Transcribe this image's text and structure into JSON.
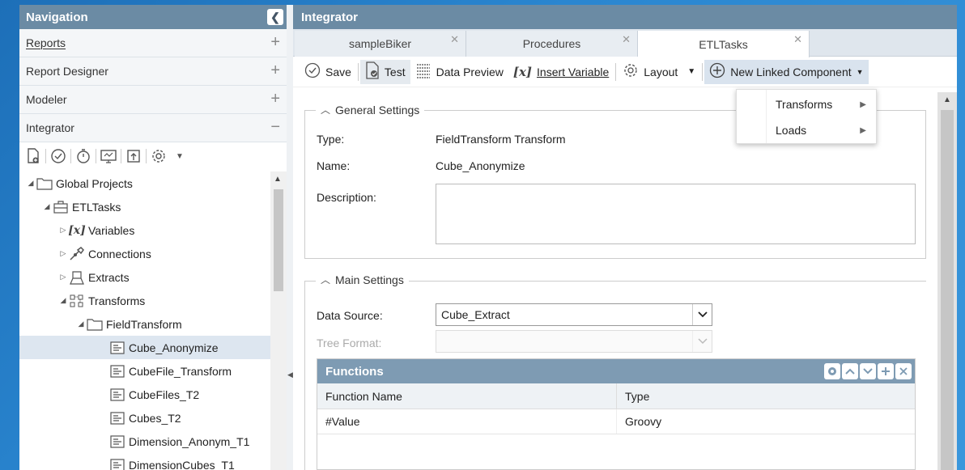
{
  "nav": {
    "title": "Navigation",
    "sections": [
      {
        "label": "Reports",
        "toggle": "+"
      },
      {
        "label": "Report Designer",
        "toggle": "+"
      },
      {
        "label": "Modeler",
        "toggle": "+"
      },
      {
        "label": "Integrator",
        "toggle": "−"
      }
    ],
    "tree": [
      {
        "label": "Global Projects",
        "expander": "◢",
        "icon": "folder-icon"
      },
      {
        "label": "ETLTasks",
        "expander": "◢",
        "icon": "project-icon"
      },
      {
        "label": "Variables",
        "expander": "▷",
        "icon": "variable-icon"
      },
      {
        "label": "Connections",
        "expander": "▷",
        "icon": "connection-icon"
      },
      {
        "label": "Extracts",
        "expander": "▷",
        "icon": "extract-icon"
      },
      {
        "label": "Transforms",
        "expander": "◢",
        "icon": "transform-icon"
      },
      {
        "label": "FieldTransform",
        "expander": "◢",
        "icon": "folder-icon"
      },
      {
        "label": "Cube_Anonymize",
        "expander": "",
        "icon": "item-icon"
      },
      {
        "label": "CubeFile_Transform",
        "expander": "",
        "icon": "item-icon"
      },
      {
        "label": "CubeFiles_T2",
        "expander": "",
        "icon": "item-icon"
      },
      {
        "label": "Cubes_T2",
        "expander": "",
        "icon": "item-icon"
      },
      {
        "label": "Dimension_Anonym_T1",
        "expander": "",
        "icon": "item-icon"
      },
      {
        "label": "DimensionCubes_T1",
        "expander": "",
        "icon": "item-icon"
      }
    ]
  },
  "main": {
    "title": "Integrator",
    "tabs": [
      {
        "label": "sampleBiker"
      },
      {
        "label": "Procedures"
      },
      {
        "label": "ETLTasks"
      }
    ],
    "toolbar": {
      "save": "Save",
      "test": "Test",
      "data_preview": "Data Preview",
      "insert_variable": "Insert Variable",
      "layout": "Layout",
      "new_linked": "New Linked Component"
    },
    "menu": {
      "items": [
        {
          "label": "Transforms"
        },
        {
          "label": "Loads"
        }
      ]
    },
    "general": {
      "legend": "General Settings",
      "type_label": "Type:",
      "type_value": "FieldTransform Transform",
      "name_label": "Name:",
      "name_value": "Cube_Anonymize",
      "desc_label": "Description:"
    },
    "mainsettings": {
      "legend": "Main Settings",
      "ds_label": "Data Source:",
      "ds_value": "Cube_Extract",
      "tf_label": "Tree Format:"
    },
    "functions": {
      "title": "Functions",
      "columns": [
        "Function Name",
        "Type"
      ],
      "rows": [
        {
          "name": "#Value",
          "type": "Groovy"
        }
      ]
    }
  },
  "colors": {
    "header": "#6b8ba4",
    "grid_header": "#7e9bb3",
    "selection": "#dde6f0",
    "background": "#2a86d0"
  }
}
